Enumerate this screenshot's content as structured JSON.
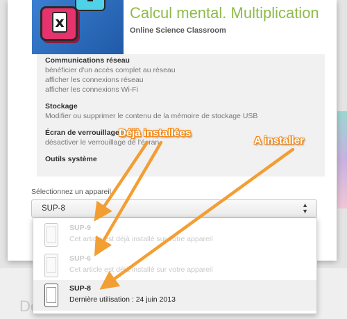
{
  "app": {
    "title": "Calcul mental. Multiplication",
    "author": "Online Science Classroom",
    "icon": "multiplication-tiles-icon"
  },
  "permissions": [
    {
      "title": "Communications réseau",
      "items": [
        "bénéficier d'un accès complet au réseau",
        "afficher les connexions réseau",
        "afficher les connexions Wi-Fi"
      ]
    },
    {
      "title": "Stockage",
      "items": [
        "Modifier ou supprimer le contenu de la mémoire de stockage USB"
      ]
    },
    {
      "title": "Écran de verrouillage",
      "items": [
        "désactiver le verrouillage de l'écran"
      ]
    },
    {
      "title": "Outils système",
      "items": []
    }
  ],
  "device_select": {
    "label": "Sélectionnez un appareil",
    "selected": "SUP-8",
    "options": [
      {
        "name": "SUP-9",
        "status": "Cet article est déjà installé sur votre appareil",
        "disabled": true
      },
      {
        "name": "SUP-6",
        "status": "Cet article est déjà installé sur votre appareil",
        "disabled": true
      },
      {
        "name": "SUP-8",
        "status": "Dernière utilisation : 24 juin 2013",
        "disabled": false
      }
    ]
  },
  "annotations": {
    "installed": "Déjà installées",
    "to_install": "A installer",
    "color": "#f39a2a"
  },
  "background": {
    "bottom_text": "Dé"
  }
}
